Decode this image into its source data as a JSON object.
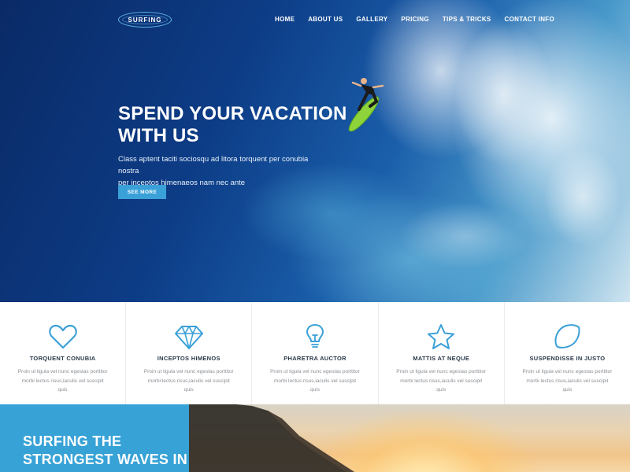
{
  "brand": {
    "logo_text": "SURFING"
  },
  "nav": {
    "items": [
      "HOME",
      "ABOUT US",
      "GALLERY",
      "PRICING",
      "TIPS & TRICKS",
      "CONTACT INFO"
    ]
  },
  "hero": {
    "title_line1": "SPEND YOUR VACATION",
    "title_line2": "WITH US",
    "subtitle_line1": "Class aptent taciti sociosqu ad litora torquent per conubia nostra",
    "subtitle_line2": "per inceptos himenaeos nam nec ante",
    "button_label": "SEE MORE"
  },
  "features": [
    {
      "icon": "heart-icon",
      "title": "TORQUENT CONUBIA",
      "text_line1": "Proin ut ligula vel nunc egestas porttitor",
      "text_line2": "morbi lectus risus,iaculis vel suscipit quis"
    },
    {
      "icon": "diamond-icon",
      "title": "INCEPTOS HIMENOS",
      "text_line1": "Proin ut ligula vel nunc egestas porttitor",
      "text_line2": "morbi lectus risus,iaculis vel suscipit quis"
    },
    {
      "icon": "lightbulb-icon",
      "title": "PHARETRA AUCTOR",
      "text_line1": "Proin ut ligula vel nunc egestas porttitor",
      "text_line2": "morbi lectus risus,iaculis vel suscipit quis"
    },
    {
      "icon": "star-icon",
      "title": "MATTIS AT NEQUE",
      "text_line1": "Proin ut ligula vel nunc egestas porttitor",
      "text_line2": "morbi lectus risus,iaculis vel suscipit quis"
    },
    {
      "icon": "lemon-icon",
      "title": "SUSPENDISSE IN JUSTO",
      "text_line1": "Proin ut ligula vel nunc egestas porttitor",
      "text_line2": "morbi lectus risus,iaculis vel suscipit quis"
    }
  ],
  "bottom": {
    "title_line1": "SURFING THE",
    "title_line2": "STRONGEST WAVES IN"
  },
  "colors": {
    "accent": "#37a2d6",
    "icon_stroke": "#3aa0d8",
    "heading_dark": "#2b3a4a"
  }
}
